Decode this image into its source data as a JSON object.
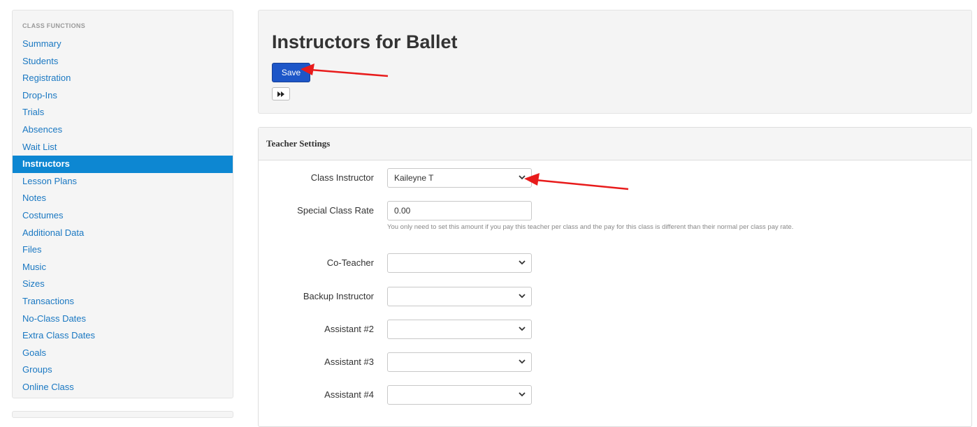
{
  "sidebar": {
    "heading": "CLASS FUNCTIONS",
    "items": [
      {
        "label": "Summary"
      },
      {
        "label": "Students"
      },
      {
        "label": "Registration"
      },
      {
        "label": "Drop-Ins"
      },
      {
        "label": "Trials"
      },
      {
        "label": "Absences"
      },
      {
        "label": "Wait List"
      },
      {
        "label": "Instructors",
        "active": true
      },
      {
        "label": "Lesson Plans"
      },
      {
        "label": "Notes"
      },
      {
        "label": "Costumes"
      },
      {
        "label": "Additional Data"
      },
      {
        "label": "Files"
      },
      {
        "label": "Music"
      },
      {
        "label": "Sizes"
      },
      {
        "label": "Transactions"
      },
      {
        "label": "No-Class Dates"
      },
      {
        "label": "Extra Class Dates"
      },
      {
        "label": "Goals"
      },
      {
        "label": "Groups"
      },
      {
        "label": "Online Class"
      }
    ]
  },
  "header": {
    "title": "Instructors for Ballet",
    "save_label": "Save",
    "forward_icon": "fast-forward-icon"
  },
  "panel": {
    "heading": "Teacher Settings",
    "fields": {
      "class_instructor": {
        "label": "Class Instructor",
        "value": "Kaileyne T"
      },
      "special_rate": {
        "label": "Special Class Rate",
        "value": "0.00",
        "help": "You only need to set this amount if you pay this teacher per class and the pay for this class is different than their normal per class pay rate."
      },
      "co_teacher": {
        "label": "Co-Teacher",
        "value": ""
      },
      "backup_instructor": {
        "label": "Backup Instructor",
        "value": ""
      },
      "assistant_2": {
        "label": "Assistant #2",
        "value": ""
      },
      "assistant_3": {
        "label": "Assistant #3",
        "value": ""
      },
      "assistant_4": {
        "label": "Assistant #4",
        "value": ""
      }
    }
  },
  "colors": {
    "link": "#1a78c2",
    "active_bg": "#0d87d2",
    "save_bg": "#1d56c8",
    "annotation_arrow": "#e81b1b"
  }
}
